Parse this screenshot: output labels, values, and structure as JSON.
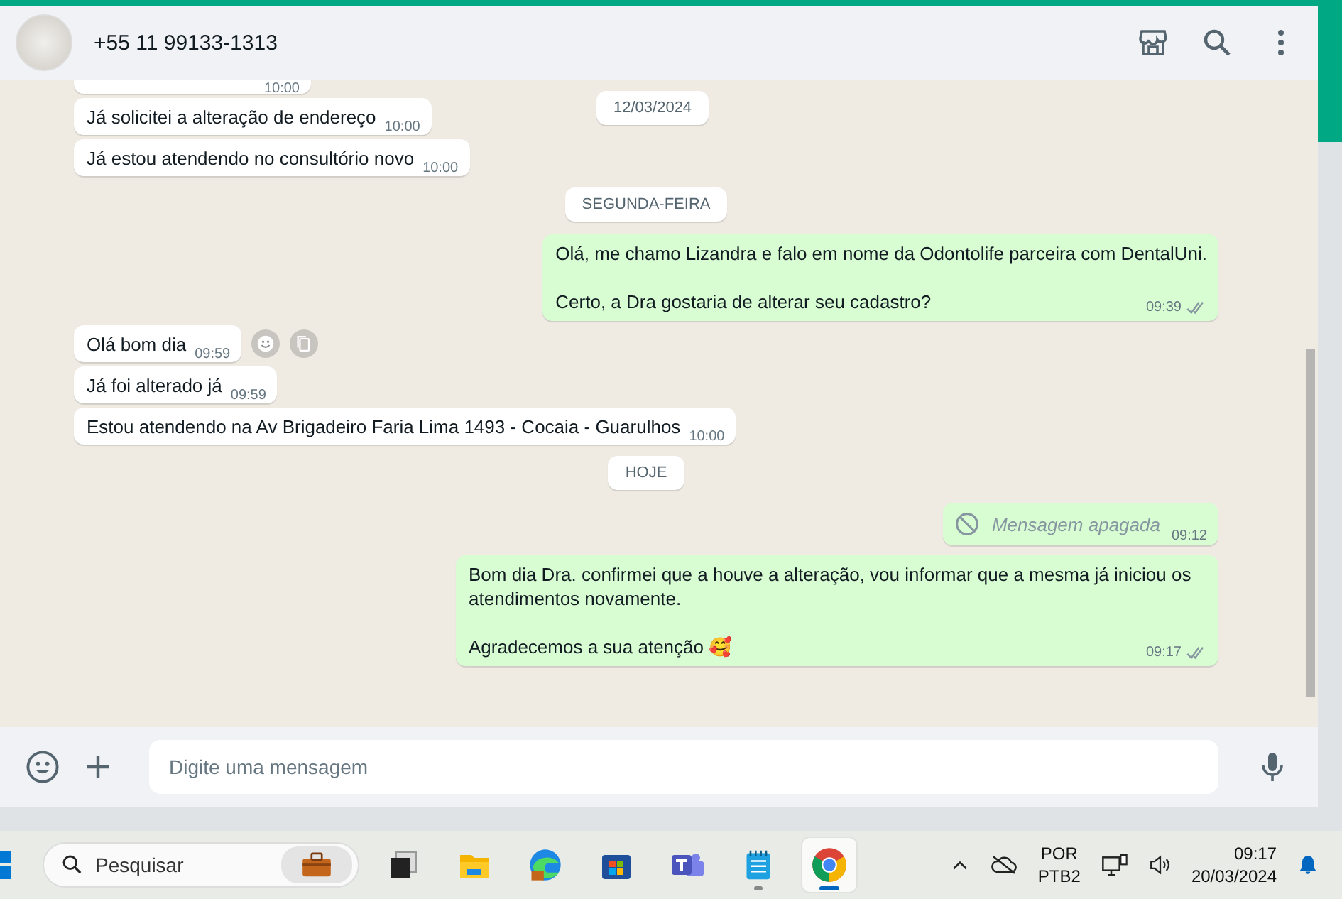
{
  "header": {
    "contact": "+55 11 99133-1313"
  },
  "sticky_date": "12/03/2024",
  "messages": [
    {
      "kind": "incoming",
      "time": "10:00",
      "hover_actions": false
    },
    {
      "kind": "incoming",
      "paragraphs": [
        "Já solicitei a alteração de endereço"
      ],
      "time": "10:00",
      "hover_actions": false
    },
    {
      "kind": "incoming",
      "paragraphs": [
        "Já estou atendendo no consultório novo"
      ],
      "time": "10:00",
      "hover_actions": false
    },
    {
      "kind": "date",
      "text": "SEGUNDA-FEIRA"
    },
    {
      "kind": "outgoing",
      "paragraphs": [
        "Olá, me chamo Lizandra e falo em nome da Odontolife parceira com DentalUni.",
        "Certo, a Dra gostaria de alterar seu cadastro?"
      ],
      "time": "09:39",
      "delivered": true
    },
    {
      "kind": "incoming",
      "paragraphs": [
        "Olá bom dia"
      ],
      "time": "09:59",
      "hover_actions": true
    },
    {
      "kind": "incoming",
      "paragraphs": [
        "Já foi alterado já"
      ],
      "time": "09:59",
      "hover_actions": false
    },
    {
      "kind": "incoming",
      "paragraphs": [
        "Estou atendendo na Av Brigadeiro Faria Lima 1493 - Cocaia - Guarulhos"
      ],
      "time": "10:00",
      "hover_actions": false
    },
    {
      "kind": "date",
      "text": "HOJE"
    },
    {
      "kind": "deleted",
      "text": "Mensagem apagada",
      "time": "09:12"
    },
    {
      "kind": "outgoing",
      "paragraphs": [
        "Bom dia Dra. confirmei que a houve a alteração, vou informar que a mesma já iniciou os atendimentos novamente.",
        "Agradecemos a sua atenção 🥰"
      ],
      "time": "09:17",
      "delivered": true
    }
  ],
  "composer": {
    "placeholder": "Digite uma mensagem"
  },
  "taskbar": {
    "search_placeholder": "Pesquisar",
    "apps": [
      {
        "kind": "taskview",
        "selected": false,
        "running": false
      },
      {
        "kind": "files",
        "selected": false,
        "running": false
      },
      {
        "kind": "edge",
        "selected": false,
        "running": false
      },
      {
        "kind": "store",
        "selected": false,
        "running": false
      },
      {
        "kind": "teams",
        "selected": false,
        "running": false
      },
      {
        "kind": "notepad",
        "selected": false,
        "running": true
      },
      {
        "kind": "chrome",
        "selected": true,
        "running": true
      }
    ],
    "language": "POR",
    "layout": "PTB2",
    "time": "09:17",
    "date": "20/03/2024"
  }
}
